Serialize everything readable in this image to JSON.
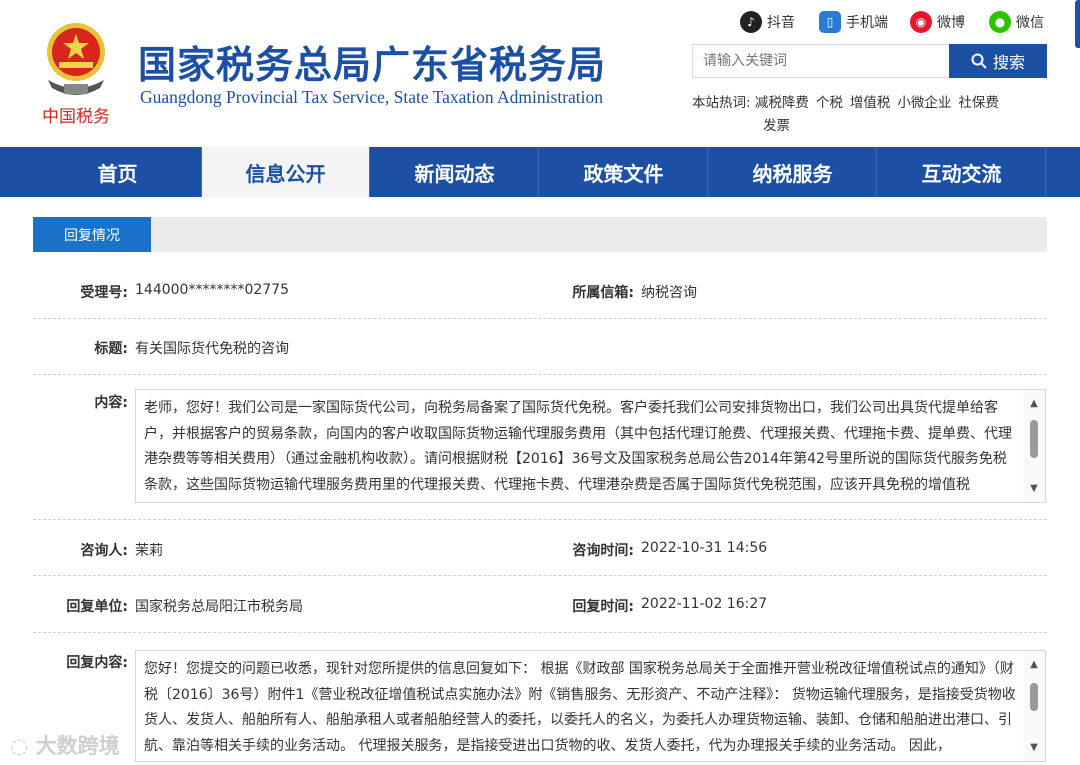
{
  "header": {
    "site_title": "国家税务总局广东省税务局",
    "site_subtitle": "Guangdong Provincial Tax Service, State Taxation Administration",
    "emblem_caption": "中国税务",
    "social": [
      {
        "label": "抖音",
        "icon": "douyin-icon",
        "color": "#222222"
      },
      {
        "label": "手机端",
        "icon": "mobile-icon",
        "color": "#2a7bd6"
      },
      {
        "label": "微博",
        "icon": "weibo-icon",
        "color": "#e6162d"
      },
      {
        "label": "微信",
        "icon": "wechat-icon",
        "color": "#2dc100"
      }
    ],
    "search_placeholder": "请输入关键词",
    "search_button": "搜索",
    "hot_label": "本站热词:",
    "hot_words": [
      "减税降费",
      "个税",
      "增值税",
      "小微企业",
      "社保费",
      "发票"
    ]
  },
  "nav": {
    "items": [
      {
        "label": "首页"
      },
      {
        "label": "信息公开"
      },
      {
        "label": "新闻动态"
      },
      {
        "label": "政策文件"
      },
      {
        "label": "纳税服务"
      },
      {
        "label": "互动交流"
      }
    ],
    "active_index": 1
  },
  "tab": {
    "label": "回复情况"
  },
  "detail": {
    "acceptance_no_label": "受理号:",
    "acceptance_no": "144000********02775",
    "channel_label": "所属信箱:",
    "channel": "纳税咨询",
    "title_label": "标题:",
    "title": "有关国际货代免税的咨询",
    "content_label": "内容:",
    "content": "老师，您好！我们公司是一家国际货代公司，向税务局备案了国际货代免税。客户委托我们公司安排货物出口，我们公司出具货代提单给客户，并根据客户的贸易条款，向国内的客户收取国际货物运输代理服务费用（其中包括代理订舱费、代理报关费、代理拖卡费、提单费、代理港杂费等等相关费用）（通过金融机构收款）。请问根据财税【2016】36号文及国家税务总局公告2014年第42号里所说的国际货代服务免税条款，这些国际货物运输代理服务费用里的代理报关费、代理拖卡费、代理港杂费是否属于国际货代免税范围，应该开具免税的增值税",
    "asker_label": "咨询人:",
    "asker": "茉莉",
    "ask_time_label": "咨询时间:",
    "ask_time": "2022-10-31 14:56",
    "reply_unit_label": "回复单位:",
    "reply_unit": "国家税务总局阳江市税务局",
    "reply_time_label": "回复时间:",
    "reply_time": "2022-11-02 16:27",
    "reply_content_label": "回复内容:",
    "reply_content": "您好！您提交的问题已收悉，现针对您所提供的信息回复如下： 根据《财政部 国家税务总局关于全面推开营业税改征增值税试点的通知》（财税〔2016〕36号）附件1《营业税改征增值税试点实施办法》附《销售服务、无形资产、不动产注释》： 货物运输代理服务，是指接受货物收货人、发货人、船舶所有人、船舶承租人或者船舶经营人的委托，以委托人的名义，为委托人办理货物运输、装卸、仓储和船舶进出港口、引航、靠泊等相关手续的业务活动。 代理报关服务，是指接受进出口货物的收、发货人委托，代为办理报关手续的业务活动。 因此，"
  },
  "watermark": "大数跨境"
}
